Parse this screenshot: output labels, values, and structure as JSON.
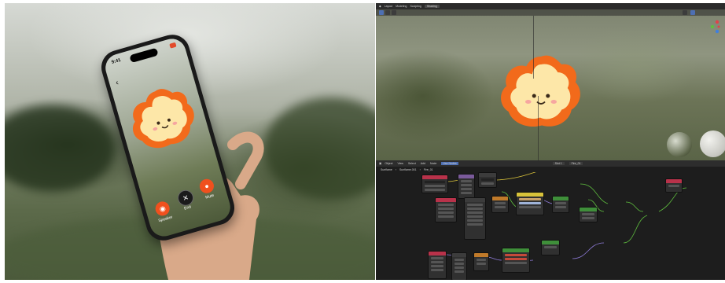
{
  "phone": {
    "time": "9:41",
    "call_buttons": [
      {
        "label": "Speaker",
        "icon": "speaker-icon",
        "color": "#f0501e"
      },
      {
        "label": "End",
        "icon": "close-icon",
        "color": "#1b1b1b"
      },
      {
        "label": "Mute",
        "icon": "microphone-icon",
        "color": "#f0501e"
      }
    ]
  },
  "blender": {
    "topbar": {
      "menus": [
        "Layout",
        "Modeling",
        "Sculpting",
        "Shading"
      ],
      "active_tab": "Shading"
    },
    "node_editor": {
      "header_items": [
        "Object",
        "View",
        "Select",
        "Add",
        "Node",
        "Use Nodes"
      ],
      "slot": "Slot 1",
      "material": "Fire_01",
      "breadcrumb": [
        "Sunflame",
        "Sunflame.001",
        "Fire_01"
      ]
    }
  },
  "colors": {
    "accent": "#f0501e",
    "blender_bg": "#1d1d1d",
    "node_link_green": "#5fbf3f",
    "node_link_yellow": "#d8c23a",
    "node_link_purple": "#8d7ad6"
  }
}
